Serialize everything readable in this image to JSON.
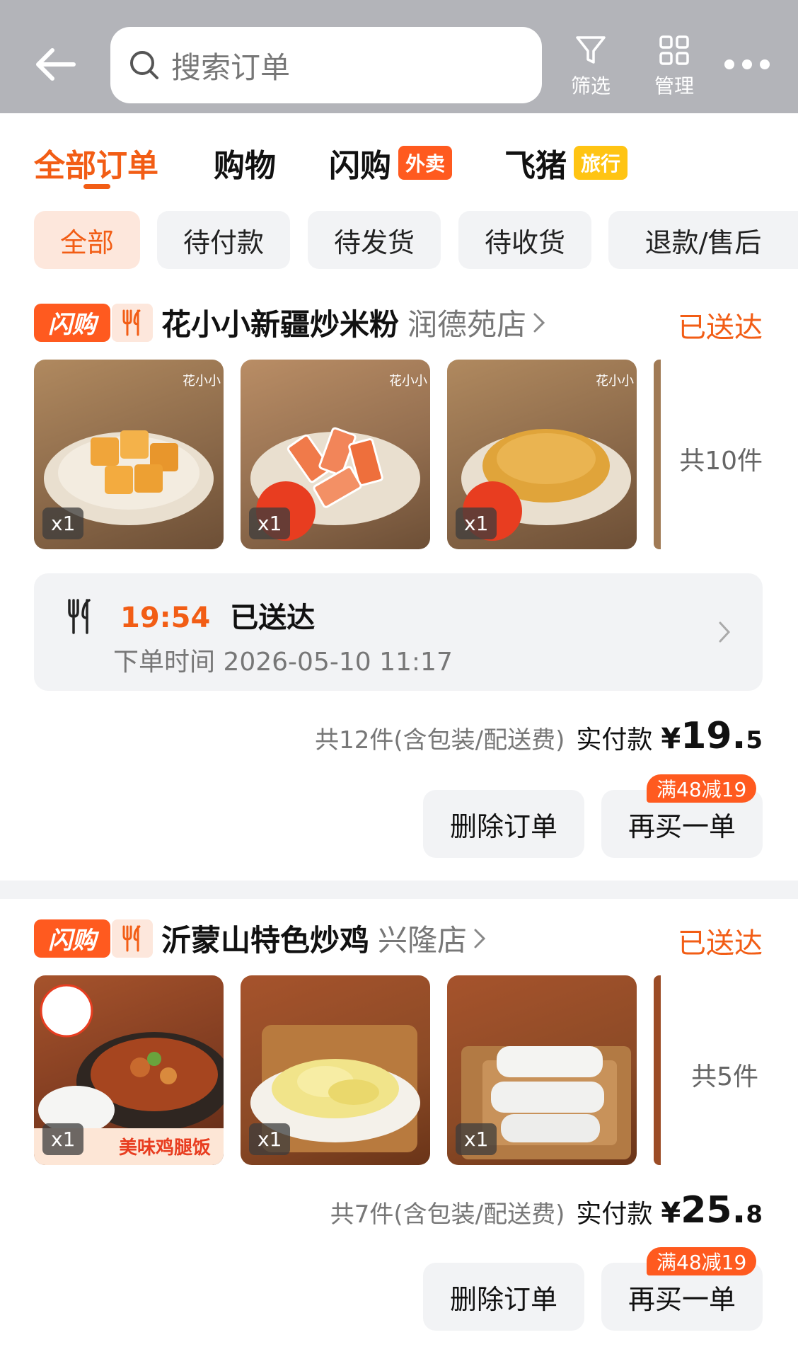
{
  "header": {
    "search_placeholder": "搜索订单",
    "filter_label": "筛选",
    "manage_label": "管理"
  },
  "tabs": [
    {
      "label": "全部订单",
      "active": true
    },
    {
      "label": "购物"
    },
    {
      "label": "闪购",
      "badge": "外卖"
    },
    {
      "label": "飞猪",
      "badge": "旅行"
    }
  ],
  "filters": [
    {
      "label": "全部",
      "active": true
    },
    {
      "label": "待付款"
    },
    {
      "label": "待发货"
    },
    {
      "label": "待收货"
    },
    {
      "label": "退款/售后"
    }
  ],
  "orders": [
    {
      "badge": "闪购",
      "store": "花小小新疆炒米粉",
      "branch": "润德苑店",
      "status": "已送达",
      "thumbnails": [
        {
          "name": "fried-tofu-cubes",
          "qty": "x1"
        },
        {
          "name": "crab-sticks",
          "qty": "x1"
        },
        {
          "name": "fried-soybeans",
          "qty": "x1"
        }
      ],
      "total_items": "共10件",
      "delivery_time": "19:54",
      "delivery_status": "已送达",
      "order_time": "下单时间 2026-05-10 11:17",
      "summary_count": "共12件(含包装/配送费)",
      "paid_label": "实付款",
      "currency": "¥",
      "amount_main": "19.",
      "amount_dec": "5",
      "delete_label": "删除订单",
      "rebuy_label": "再买一单",
      "promo": "满48减19"
    },
    {
      "badge": "闪购",
      "store": "沂蒙山特色炒鸡",
      "branch": "兴隆店",
      "status": "已送达",
      "thumbnails": [
        {
          "name": "spicy-stir-fried-chicken",
          "qty": "x1"
        },
        {
          "name": "napa-cabbage",
          "qty": "x1"
        },
        {
          "name": "glass-noodles",
          "qty": "x1"
        }
      ],
      "total_items": "共5件",
      "summary_count": "共7件(含包装/配送费)",
      "paid_label": "实付款",
      "currency": "¥",
      "amount_main": "25.",
      "amount_dec": "8",
      "delete_label": "删除订单",
      "rebuy_label": "再买一单",
      "promo": "满48减19"
    }
  ],
  "colors": {
    "accent": "#f25d15",
    "header_bg": "#b3b4b9",
    "chip_bg": "#f2f3f5",
    "chip_active_bg": "#fde7dc"
  }
}
